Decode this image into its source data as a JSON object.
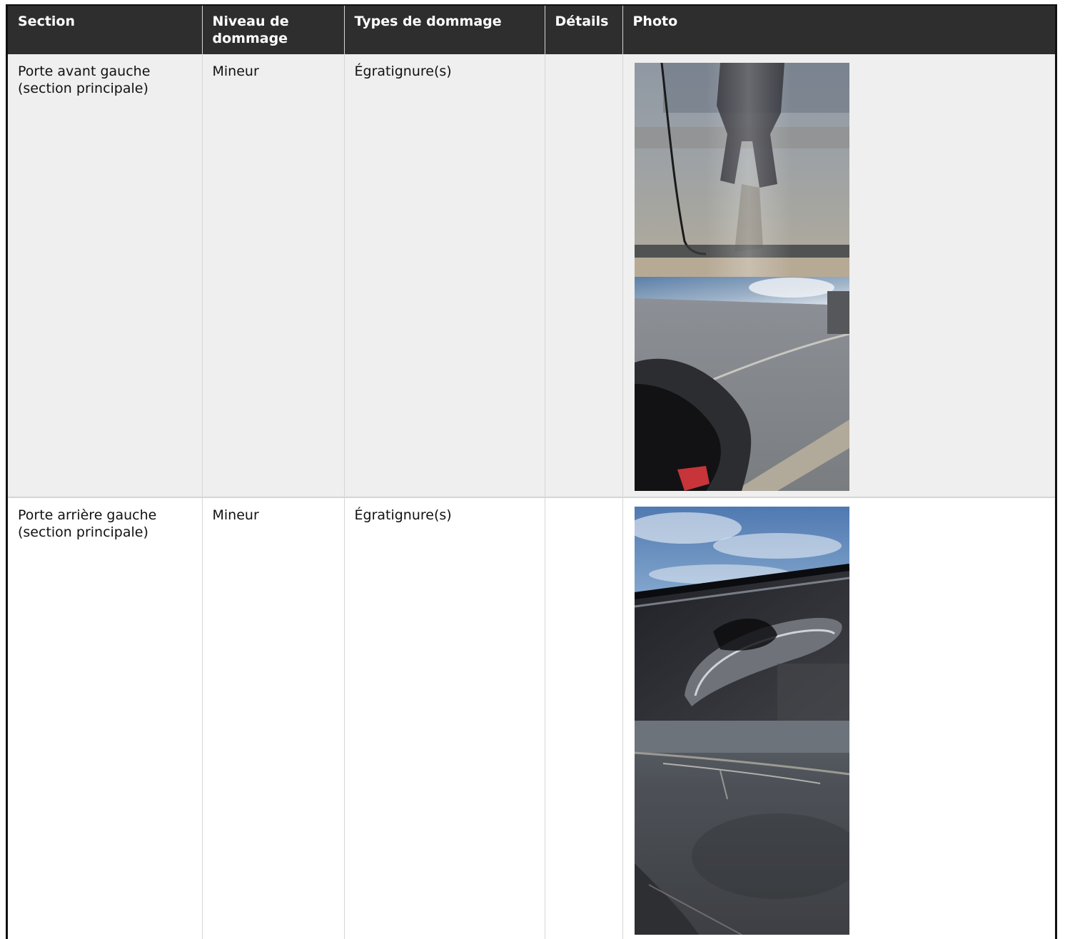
{
  "table": {
    "headers": {
      "section": "Section",
      "level": "Niveau de dommage",
      "types": "Types de dommage",
      "details": "Détails",
      "photo": "Photo"
    },
    "rows": [
      {
        "section": "Porte avant gauche (section principale)",
        "level": "Mineur",
        "types": "Égratignure(s)",
        "details": "",
        "photos": [
          "door-reflection-photo",
          "door-side-photo"
        ]
      },
      {
        "section": "Porte arrière gauche (section principale)",
        "level": "Mineur",
        "types": "Égratignure(s)",
        "details": "",
        "photos": [
          "door-handle-photo",
          "door-panel-scratch-photo"
        ]
      }
    ]
  },
  "colors": {
    "header_bg": "#2e2e2e",
    "row_alt_bg": "#efefef",
    "border": "#d6d6d6"
  }
}
